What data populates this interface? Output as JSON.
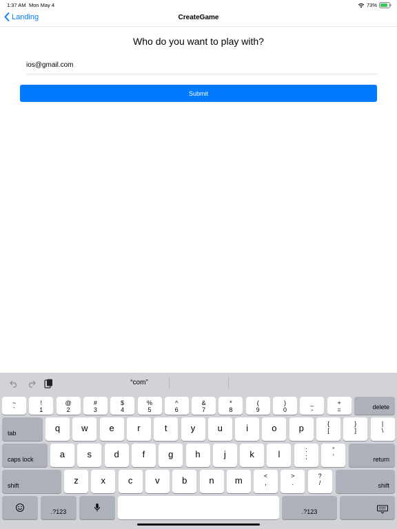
{
  "status": {
    "time": "1:37 AM",
    "date": "Mon May 4",
    "battery": "73%"
  },
  "nav": {
    "back_label": "Landing",
    "title": "CreateGame"
  },
  "main": {
    "question": "Who do you want to play with?",
    "email_value": "ios@gmail.com",
    "submit_label": "Submit"
  },
  "keyboard": {
    "suggestion": "“com”",
    "row1": [
      {
        "top": "~",
        "bot": "`"
      },
      {
        "top": "!",
        "bot": "1"
      },
      {
        "top": "@",
        "bot": "2"
      },
      {
        "top": "#",
        "bot": "3"
      },
      {
        "top": "$",
        "bot": "4"
      },
      {
        "top": "%",
        "bot": "5"
      },
      {
        "top": "^",
        "bot": "6"
      },
      {
        "top": "&",
        "bot": "7"
      },
      {
        "top": "*",
        "bot": "8"
      },
      {
        "top": "(",
        "bot": "9"
      },
      {
        "top": ")",
        "bot": "0"
      },
      {
        "top": "_",
        "bot": "-"
      },
      {
        "top": "+",
        "bot": "="
      }
    ],
    "delete_label": "delete",
    "tab_label": "tab",
    "row2": [
      "q",
      "w",
      "e",
      "r",
      "t",
      "y",
      "u",
      "i",
      "o",
      "p"
    ],
    "row2_punct": [
      {
        "top": "{",
        "bot": "["
      },
      {
        "top": "}",
        "bot": "]"
      },
      {
        "top": "|",
        "bot": "\\"
      }
    ],
    "caps_label": "caps lock",
    "row3": [
      "a",
      "s",
      "d",
      "f",
      "g",
      "h",
      "j",
      "k",
      "l"
    ],
    "row3_punct": [
      {
        "top": ":",
        "bot": ";"
      },
      {
        "top": "”",
        "bot": "’"
      }
    ],
    "return_label": "return",
    "shift_label": "shift",
    "row4": [
      "z",
      "x",
      "c",
      "v",
      "b",
      "n",
      "m"
    ],
    "row4_punct": [
      {
        "top": "<",
        "bot": ","
      },
      {
        "top": ">",
        "bot": "."
      },
      {
        "top": "?",
        "bot": "/"
      }
    ],
    "numbers_label": ".?123"
  }
}
